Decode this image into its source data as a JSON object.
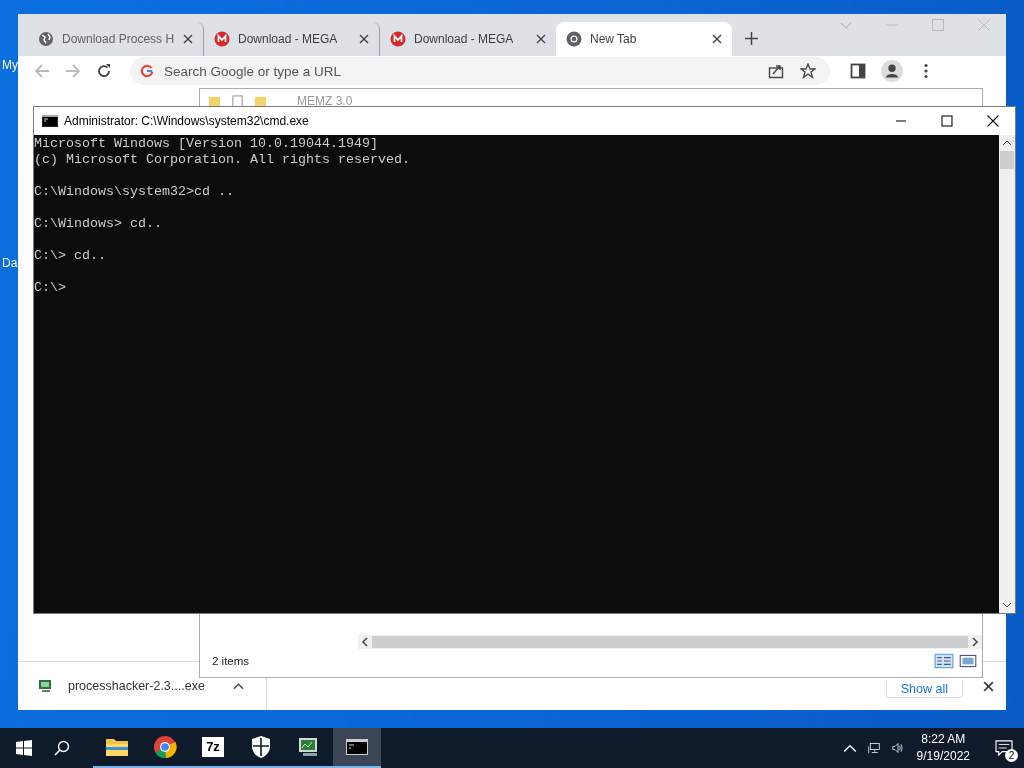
{
  "desktop": {
    "icon_labels": [
      "My",
      "Da"
    ]
  },
  "chrome": {
    "tabs": [
      {
        "title": "Download Process H",
        "kind": "globe",
        "selected": false
      },
      {
        "title": "Download - MEGA",
        "kind": "mega",
        "selected": false
      },
      {
        "title": "Download - MEGA",
        "kind": "mega",
        "selected": false
      },
      {
        "title": "New Tab",
        "kind": "chrome",
        "selected": true
      }
    ],
    "omnibox": {
      "placeholder": "Search Google or type a URL"
    },
    "download_bar": {
      "file": "processhacker-2.3....exe",
      "show_all": "Show all"
    }
  },
  "explorer": {
    "title": "MEMZ 3.0",
    "status": "2 items"
  },
  "cmd": {
    "title": "Administrator: C:\\Windows\\system32\\cmd.exe",
    "lines": [
      {
        "kind": "banner",
        "text": "Microsoft Windows [Version 10.0.19044.1949]"
      },
      {
        "kind": "banner",
        "text": "(c) Microsoft Corporation. All rights reserved."
      },
      {
        "kind": "prompt",
        "text": "C:\\Windows\\system32>cd .."
      },
      {
        "kind": "prompt",
        "text": "C:\\Windows> cd.."
      },
      {
        "kind": "prompt",
        "text": "C:\\> cd.."
      },
      {
        "kind": "prompt",
        "text": "C:\\>"
      }
    ]
  },
  "taskbar": {
    "apps": [
      {
        "kind": "explorer",
        "active": false
      },
      {
        "kind": "chrome",
        "active": false
      },
      {
        "kind": "sevenzip",
        "label": "7z",
        "active": false
      },
      {
        "kind": "shield",
        "active": false
      },
      {
        "kind": "monitor",
        "active": false
      },
      {
        "kind": "console",
        "active": true
      }
    ],
    "clock": {
      "time": "8:22 AM",
      "date": "9/19/2022"
    },
    "notifications": "2"
  }
}
